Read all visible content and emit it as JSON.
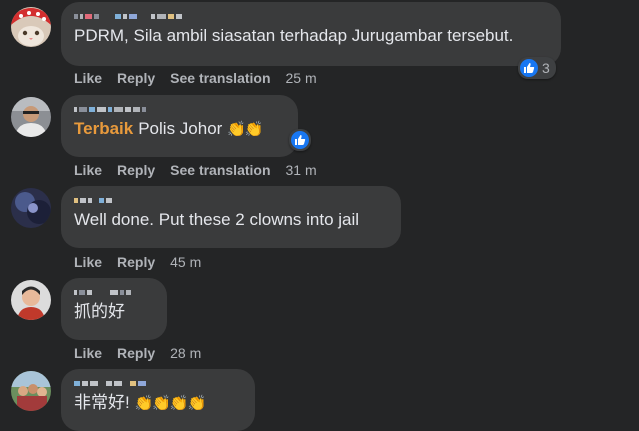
{
  "comments": [
    {
      "author": "",
      "text": "PDRM, Sila ambil siasatan terhadap Jurugambar tersebut.",
      "actions": {
        "like": "Like",
        "reply": "Reply",
        "translate": "See translation",
        "time": "25 m"
      },
      "reaction": {
        "icon": "like-icon",
        "count": "3"
      },
      "avatar": "cat-in-red-hat"
    },
    {
      "author": "",
      "badge": "Terbaik",
      "text": "Polis Johor",
      "emoji": "👏👏",
      "actions": {
        "like": "Like",
        "reply": "Reply",
        "translate": "See translation",
        "time": "31 m"
      },
      "reaction": {
        "icon": "like-icon"
      },
      "avatar": "man-photo"
    },
    {
      "author": "",
      "text": "Well done. Put these 2 clowns into jail",
      "actions": {
        "like": "Like",
        "reply": "Reply",
        "time": "45 m"
      },
      "avatar": "dark-photo"
    },
    {
      "author": "",
      "text": "抓的好",
      "actions": {
        "like": "Like",
        "reply": "Reply",
        "time": "28 m"
      },
      "avatar": "child-photo"
    },
    {
      "author": "",
      "text": "非常好!",
      "emoji": "👏👏👏👏",
      "avatar": "group-photo"
    }
  ],
  "colors": {
    "background": "#242526",
    "bubble": "#3a3b3c",
    "text": "#e4e6eb",
    "secondary": "#b0b3b8",
    "badge": "#e89a3c",
    "like_blue": "#1877f2"
  }
}
